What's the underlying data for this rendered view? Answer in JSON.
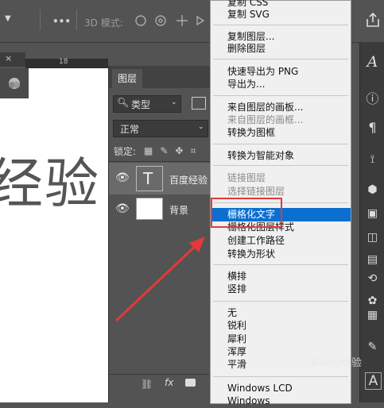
{
  "options_bar": {
    "mode_label": "3D 模式:",
    "more_label": "•••"
  },
  "canvas": {
    "ruler_number": "18",
    "text": "经验"
  },
  "layers_panel": {
    "tab_label": "图层",
    "filter_value": "类型",
    "blend_value": "正常",
    "lock_label": "锁定:",
    "layers": [
      {
        "name": "百度经验",
        "thumb": "T"
      },
      {
        "name": "背景",
        "thumb": ""
      }
    ],
    "footer_fx": "fx"
  },
  "context_menu": {
    "items": [
      {
        "label": "复制 CSS",
        "state": "normal"
      },
      {
        "label": "复制 SVG",
        "state": "normal"
      },
      {
        "label": "复制图层...",
        "state": "normal"
      },
      {
        "label": "删除图层",
        "state": "normal"
      },
      {
        "label": "快速导出为 PNG",
        "state": "normal"
      },
      {
        "label": "导出为...",
        "state": "normal"
      },
      {
        "label": "来自图层的画板...",
        "state": "normal"
      },
      {
        "label": "来自图层的画框...",
        "state": "disabled"
      },
      {
        "label": "转换为图框",
        "state": "normal"
      },
      {
        "label": "转换为智能对象",
        "state": "normal"
      },
      {
        "label": "链接图层",
        "state": "disabled"
      },
      {
        "label": "选择链接图层",
        "state": "disabled"
      },
      {
        "label": "栅格化文字",
        "state": "highlighted"
      },
      {
        "label": "栅格化图层样式",
        "state": "normal"
      },
      {
        "label": "创建工作路径",
        "state": "normal"
      },
      {
        "label": "转换为形状",
        "state": "normal"
      },
      {
        "label": "横排",
        "state": "normal"
      },
      {
        "label": "竖排",
        "state": "normal"
      },
      {
        "label": "无",
        "state": "normal"
      },
      {
        "label": "锐利",
        "state": "normal"
      },
      {
        "label": "犀利",
        "state": "normal"
      },
      {
        "label": "浑厚",
        "state": "normal"
      },
      {
        "label": "平滑",
        "state": "normal"
      },
      {
        "label": "Windows LCD",
        "state": "normal"
      },
      {
        "label": "Windows",
        "state": "normal"
      }
    ]
  },
  "right_toolbar": {
    "icons": [
      "type-icon",
      "info-icon",
      "paragraph-icon",
      "path-icon",
      "3d-icon",
      "layers-icon",
      "channels-icon",
      "properties-icon",
      "paths-icon",
      "swatches-icon",
      "grid-icon",
      "edit-icon",
      "character-icon"
    ]
  },
  "watermark": "Baidu经验",
  "colors": {
    "menu_highlight": "#0a6fd0",
    "annotation_red": "#e23a3a"
  }
}
